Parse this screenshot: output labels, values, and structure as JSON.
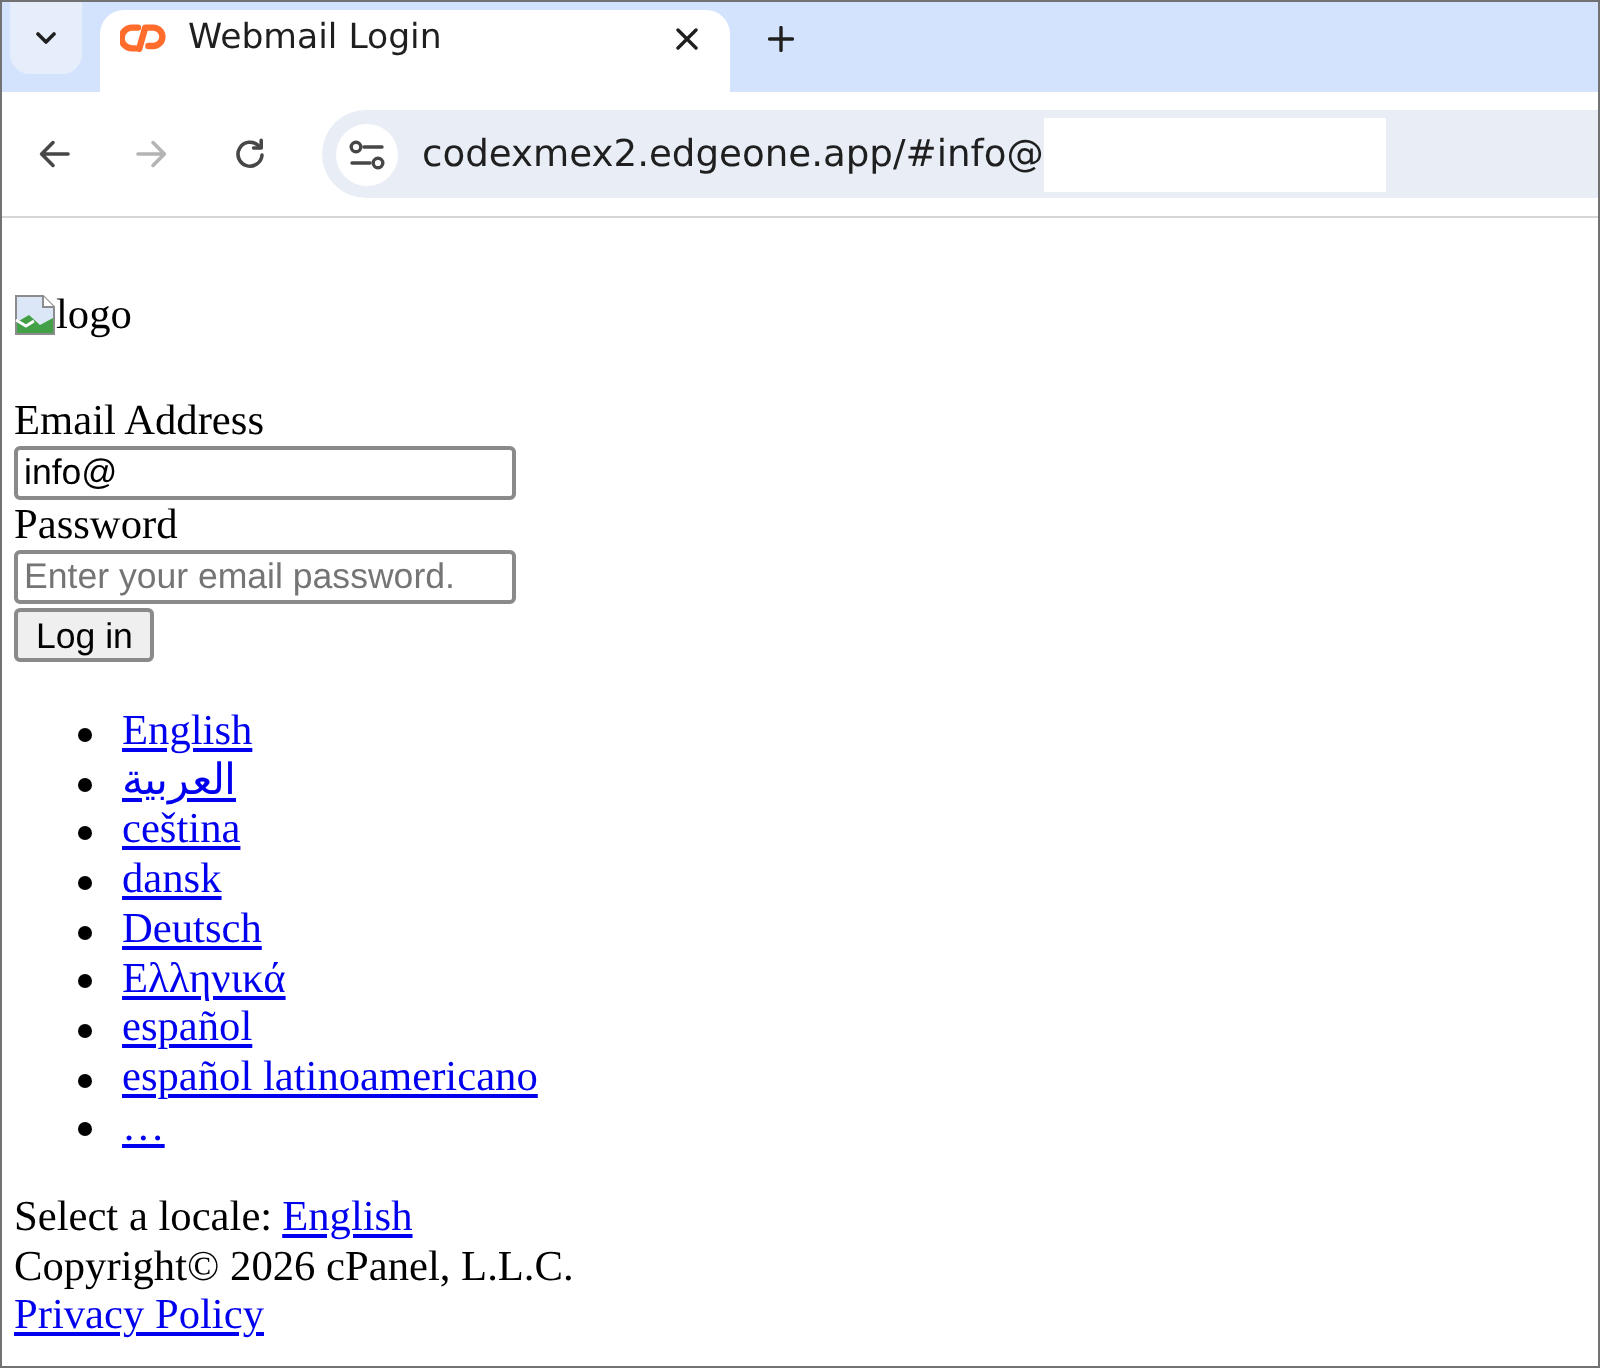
{
  "browser": {
    "tabs": [
      {
        "title": "Webmail Login",
        "selected": true
      }
    ],
    "nav_buttons": [
      {
        "kind": "back",
        "disabled": false
      },
      {
        "kind": "forward",
        "disabled": true
      },
      {
        "kind": "reload",
        "disabled": false
      }
    ],
    "address_bar": {
      "url": "codexmex2.edgeone.app/#info@"
    }
  },
  "page": {
    "logo": {
      "alt_text": "logo"
    },
    "form": {
      "fields": [
        {
          "kind": "text",
          "label": "Email Address",
          "value": "info@"
        },
        {
          "kind": "password",
          "label": "Password",
          "placeholder": "Enter your email password."
        }
      ],
      "submit_button": "Log in"
    },
    "languages": [
      "English",
      "العربية",
      "ceština",
      "dansk",
      "Deutsch",
      "Ελληνικά",
      "español",
      "español latinoamericano",
      "…"
    ],
    "locale": {
      "label": "Select a locale:",
      "link": "English"
    },
    "copyright": "Copyright© 2026 cPanel, L.L.C.",
    "privacy_link": "Privacy Policy"
  }
}
